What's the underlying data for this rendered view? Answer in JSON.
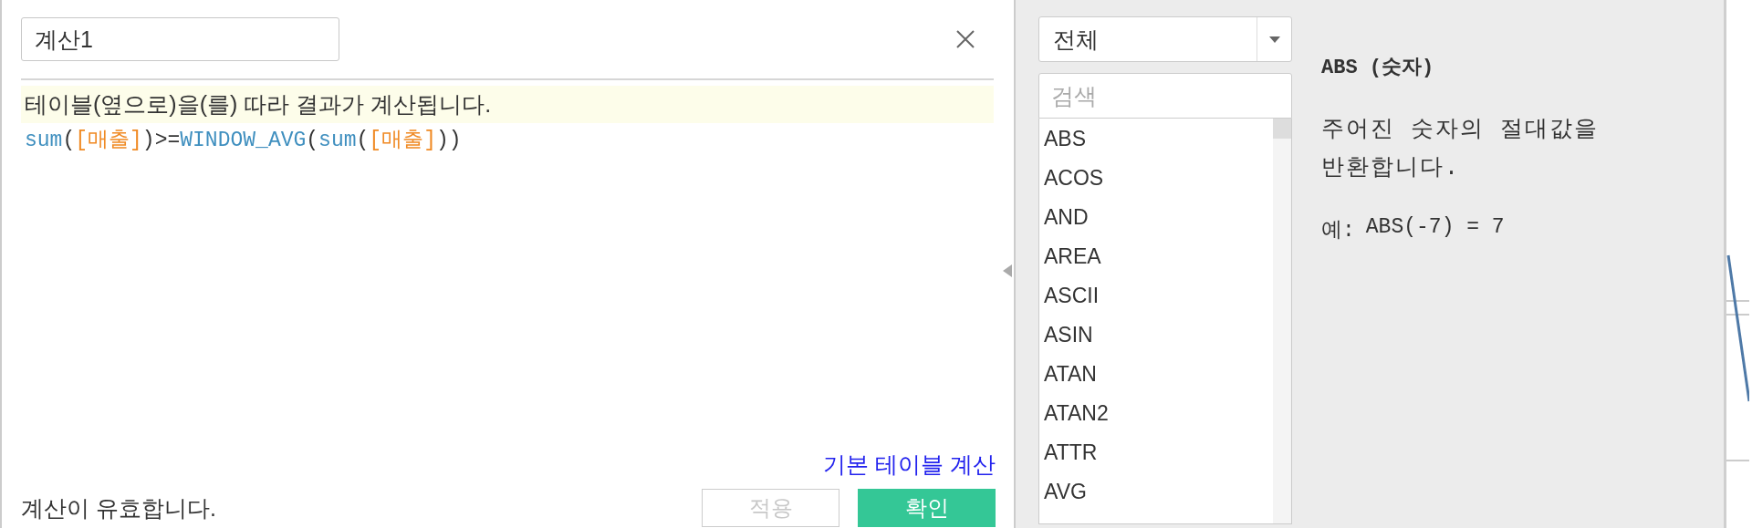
{
  "editor": {
    "name_value": "계산1",
    "notice": "테이블(옆으로)을(를) 따라 결과가 계산됩니다.",
    "formula": [
      {
        "kind": "function",
        "text": "sum"
      },
      {
        "kind": "paren",
        "text": "("
      },
      {
        "kind": "field",
        "text": "[매출]"
      },
      {
        "kind": "paren",
        "text": ")"
      },
      {
        "kind": "operator",
        "text": ">="
      },
      {
        "kind": "function",
        "text": "WINDOW_AVG"
      },
      {
        "kind": "paren",
        "text": "("
      },
      {
        "kind": "function",
        "text": "sum"
      },
      {
        "kind": "paren",
        "text": "("
      },
      {
        "kind": "field",
        "text": "[매출]"
      },
      {
        "kind": "paren",
        "text": ")"
      },
      {
        "kind": "paren",
        "text": ")"
      }
    ],
    "link": "기본 테이블 계산",
    "status": "계산이 유효합니다.",
    "buttons": [
      {
        "label": "적용",
        "kind": "secondary",
        "disabled": true
      },
      {
        "label": "확인",
        "kind": "primary",
        "disabled": false
      }
    ]
  },
  "functions": {
    "category": "전체",
    "search": {
      "placeholder": "검색"
    },
    "items": [
      "ABS",
      "ACOS",
      "AND",
      "AREA",
      "ASCII",
      "ASIN",
      "ATAN",
      "ATAN2",
      "ATTR",
      "AVG"
    ]
  },
  "help": {
    "title": "ABS (숫자)",
    "description": "주어진 숫자의 절대값을 반환합니다.",
    "example_label": "예:",
    "example_code": "ABS(-7) = 7"
  }
}
